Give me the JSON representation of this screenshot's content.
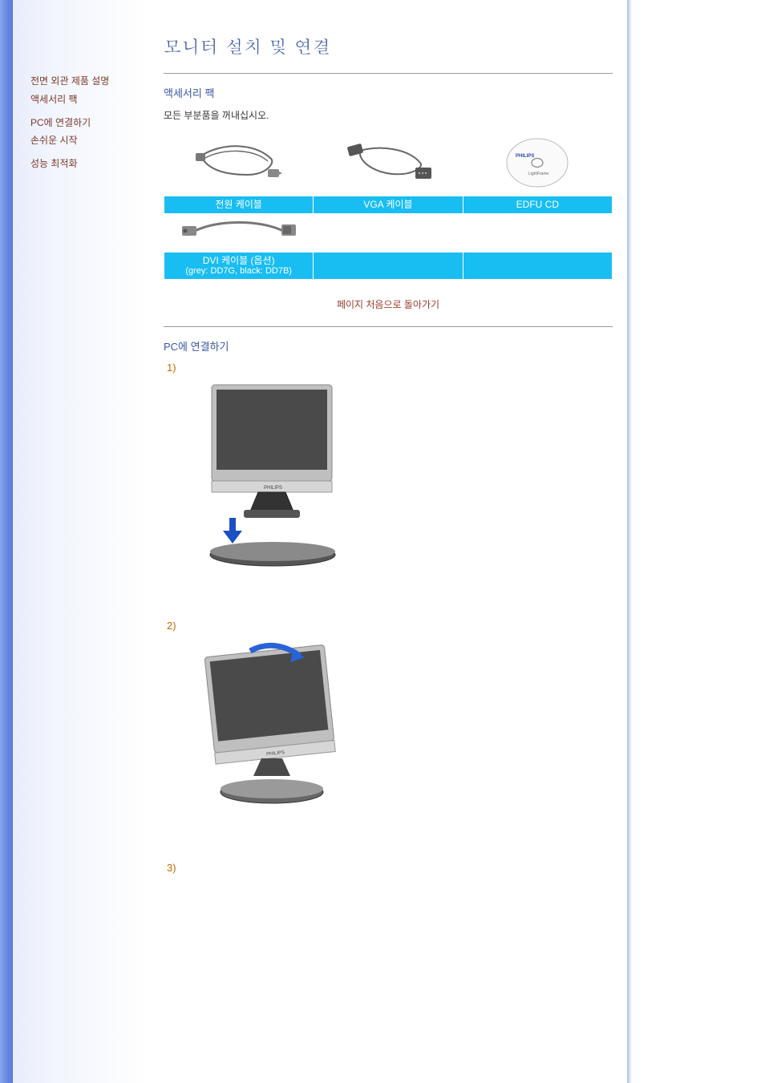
{
  "page_title": "모니터 설치 및 연결",
  "sidebar": {
    "links": [
      "전면 외관 제품 설명",
      "액세서리 팩",
      "PC에 연결하기",
      "손쉬운 시작",
      "성능 최적화"
    ]
  },
  "sections": {
    "accessories": {
      "title": "액세서리 팩",
      "note": "모든 부분품을 꺼내십시오.",
      "items_row1": {
        "power": "전원 케이블",
        "vga": "VGA 케이블",
        "cd": "EDFU CD"
      },
      "items_row2": {
        "dvi_line1": "DVI 케이블 (옵션)",
        "dvi_line2": "(grey: DD7G, black: DD7B)"
      }
    },
    "top_link": "페이지 처음으로 돌아가기",
    "connect": {
      "title": "PC에 연결하기",
      "steps": [
        "1)",
        "2)",
        "3)"
      ]
    }
  },
  "icons": {
    "cd_brand": "PHILIPS",
    "cd_sub": "LightFrame"
  }
}
